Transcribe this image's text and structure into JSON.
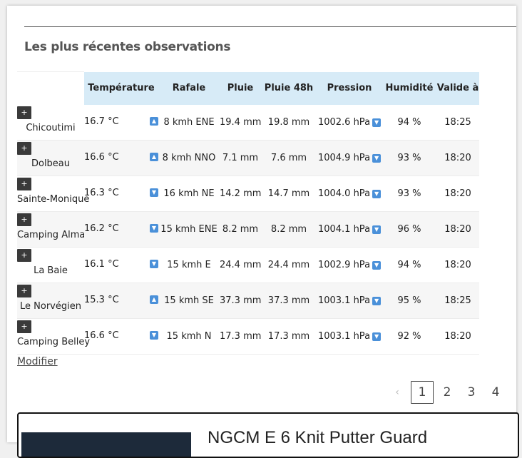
{
  "section": {
    "title": "Les plus récentes observations"
  },
  "table": {
    "headers": [
      "Température",
      "Rafale",
      "Pluie",
      "Pluie 48h",
      "Pression",
      "Humidité",
      "Valide à"
    ],
    "rows": [
      {
        "station": "Chicoutimi",
        "temp": "16.7 °C",
        "temp_trend": "up",
        "gust": "8 kmh ENE",
        "rain": "19.4 mm",
        "rain48": "19.8 mm",
        "pressure": "1002.6 hPa",
        "pressure_trend": "down",
        "humidity": "94 %",
        "valid": "18:25"
      },
      {
        "station": "Dolbeau",
        "temp": "16.6 °C",
        "temp_trend": "up",
        "gust": "8 kmh NNO",
        "rain": "7.1 mm",
        "rain48": "7.6 mm",
        "pressure": "1004.9 hPa",
        "pressure_trend": "down",
        "humidity": "93 %",
        "valid": "18:20"
      },
      {
        "station": "Sainte-Monique",
        "temp": "16.3 °C",
        "temp_trend": "down",
        "gust": "16 kmh NE",
        "rain": "14.2 mm",
        "rain48": "14.7 mm",
        "pressure": "1004.0 hPa",
        "pressure_trend": "down",
        "humidity": "93 %",
        "valid": "18:20"
      },
      {
        "station": "Camping Alma",
        "temp": "16.2 °C",
        "temp_trend": "down",
        "gust": "15 kmh ENE",
        "rain": "8.2 mm",
        "rain48": "8.2 mm",
        "pressure": "1004.1 hPa",
        "pressure_trend": "down",
        "humidity": "96 %",
        "valid": "18:20"
      },
      {
        "station": "La Baie",
        "temp": "16.1 °C",
        "temp_trend": "down",
        "gust": "15 kmh E",
        "rain": "24.4 mm",
        "rain48": "24.4 mm",
        "pressure": "1002.9 hPa",
        "pressure_trend": "down",
        "humidity": "94 %",
        "valid": "18:20"
      },
      {
        "station": "Le Norvégien",
        "temp": "15.3 °C",
        "temp_trend": "up",
        "gust": "15 kmh SE",
        "rain": "37.3 mm",
        "rain48": "37.3 mm",
        "pressure": "1003.1 hPa",
        "pressure_trend": "down",
        "humidity": "95 %",
        "valid": "18:25"
      },
      {
        "station": "Camping Belley",
        "temp": "16.6 °C",
        "temp_trend": "down",
        "gust": "15 kmh N",
        "rain": "17.3 mm",
        "rain48": "17.3 mm",
        "pressure": "1003.1 hPa",
        "pressure_trend": "down",
        "humidity": "92 %",
        "valid": "18:20"
      }
    ],
    "expand_label": "+"
  },
  "modify_link": "Modifier",
  "pagination": {
    "prev": "‹",
    "pages": [
      "1",
      "2",
      "3",
      "4"
    ],
    "current": "1"
  },
  "promo": {
    "title": "NGCM E 6 Knit Putter Guard"
  },
  "colors": {
    "header_bg": "#d7ebf7",
    "trend_icon": "#4a90d9",
    "expand_button": "#3a3a3a"
  }
}
